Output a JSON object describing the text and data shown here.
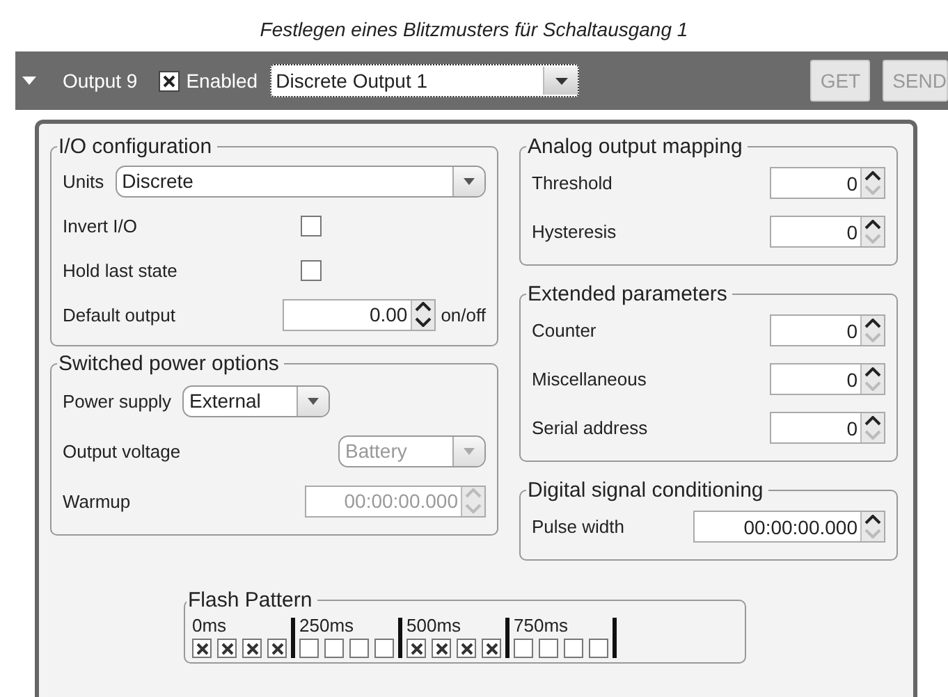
{
  "caption": "Festlegen eines Blitzmusters für Schaltausgang 1",
  "header": {
    "output_label": "Output 9",
    "enabled": {
      "label": "Enabled",
      "checked": true
    },
    "channel_select": "Discrete Output 1",
    "buttons": [
      {
        "label": "GET",
        "disabled": true
      },
      {
        "label": "SEND",
        "disabled": true
      }
    ]
  },
  "left_groups": [
    {
      "title": "I/O configuration",
      "rows": [
        {
          "kind": "dropdown",
          "label": "Units",
          "value": "Discrete",
          "wide": true,
          "disabled": false
        },
        {
          "kind": "checkbox",
          "label": "Invert I/O",
          "checked": false
        },
        {
          "kind": "checkbox",
          "label": "Hold last state",
          "checked": false
        },
        {
          "kind": "spinner",
          "label": "Default output",
          "value": "0.00",
          "unit": "on/off",
          "disabled": false,
          "at_minimum": false
        }
      ]
    },
    {
      "title": "Switched power options",
      "rows": [
        {
          "kind": "dropdown",
          "label": "Power supply",
          "value": "External",
          "wide": false,
          "disabled": false
        },
        {
          "kind": "dropdown",
          "label": "Output voltage",
          "value": "Battery",
          "wide": false,
          "disabled": true
        },
        {
          "kind": "spinner",
          "label": "Warmup",
          "value": "00:00:00.000",
          "disabled": true
        }
      ]
    }
  ],
  "right_groups": [
    {
      "title": "Analog output mapping",
      "rows": [
        {
          "kind": "spinner",
          "label": "Threshold",
          "value": "0",
          "disabled": false,
          "at_minimum": true
        },
        {
          "kind": "spinner",
          "label": "Hysteresis",
          "value": "0",
          "disabled": false,
          "at_minimum": true
        }
      ]
    },
    {
      "title": "Extended parameters",
      "rows": [
        {
          "kind": "spinner",
          "label": "Counter",
          "value": "0",
          "disabled": false,
          "at_minimum": true
        },
        {
          "kind": "spinner",
          "label": "Miscellaneous",
          "value": "0",
          "disabled": false,
          "at_minimum": true
        },
        {
          "kind": "spinner",
          "label": "Serial address",
          "value": "0",
          "disabled": false,
          "at_minimum": true
        }
      ]
    },
    {
      "title": "Digital signal conditioning",
      "rows": [
        {
          "kind": "spinner",
          "label": "Pulse width",
          "value": "00:00:00.000",
          "disabled": false,
          "at_minimum": true
        }
      ]
    }
  ],
  "flash_pattern": {
    "title": "Flash Pattern",
    "segments": [
      {
        "label": "0ms",
        "steps": [
          true,
          true,
          true,
          true
        ]
      },
      {
        "label": "250ms",
        "steps": [
          false,
          false,
          false,
          false
        ]
      },
      {
        "label": "500ms",
        "steps": [
          true,
          true,
          true,
          true
        ]
      },
      {
        "label": "750ms",
        "steps": [
          false,
          false,
          false,
          false
        ]
      }
    ]
  }
}
